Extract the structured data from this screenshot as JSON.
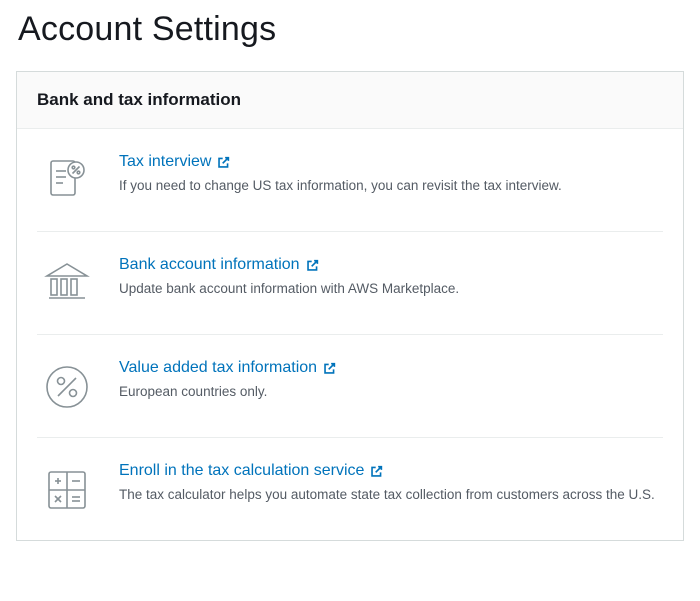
{
  "page": {
    "title": "Account Settings"
  },
  "panel": {
    "header": "Bank and tax information",
    "items": [
      {
        "link_label": "Tax interview",
        "description": "If you need to change US tax information, you can revisit the tax interview."
      },
      {
        "link_label": "Bank account information",
        "description": "Update bank account information with AWS Marketplace."
      },
      {
        "link_label": "Value added tax information",
        "description": "European countries only."
      },
      {
        "link_label": "Enroll in the tax calculation service",
        "description": "The tax calculator helps you automate state tax collection from customers across the U.S."
      }
    ]
  }
}
